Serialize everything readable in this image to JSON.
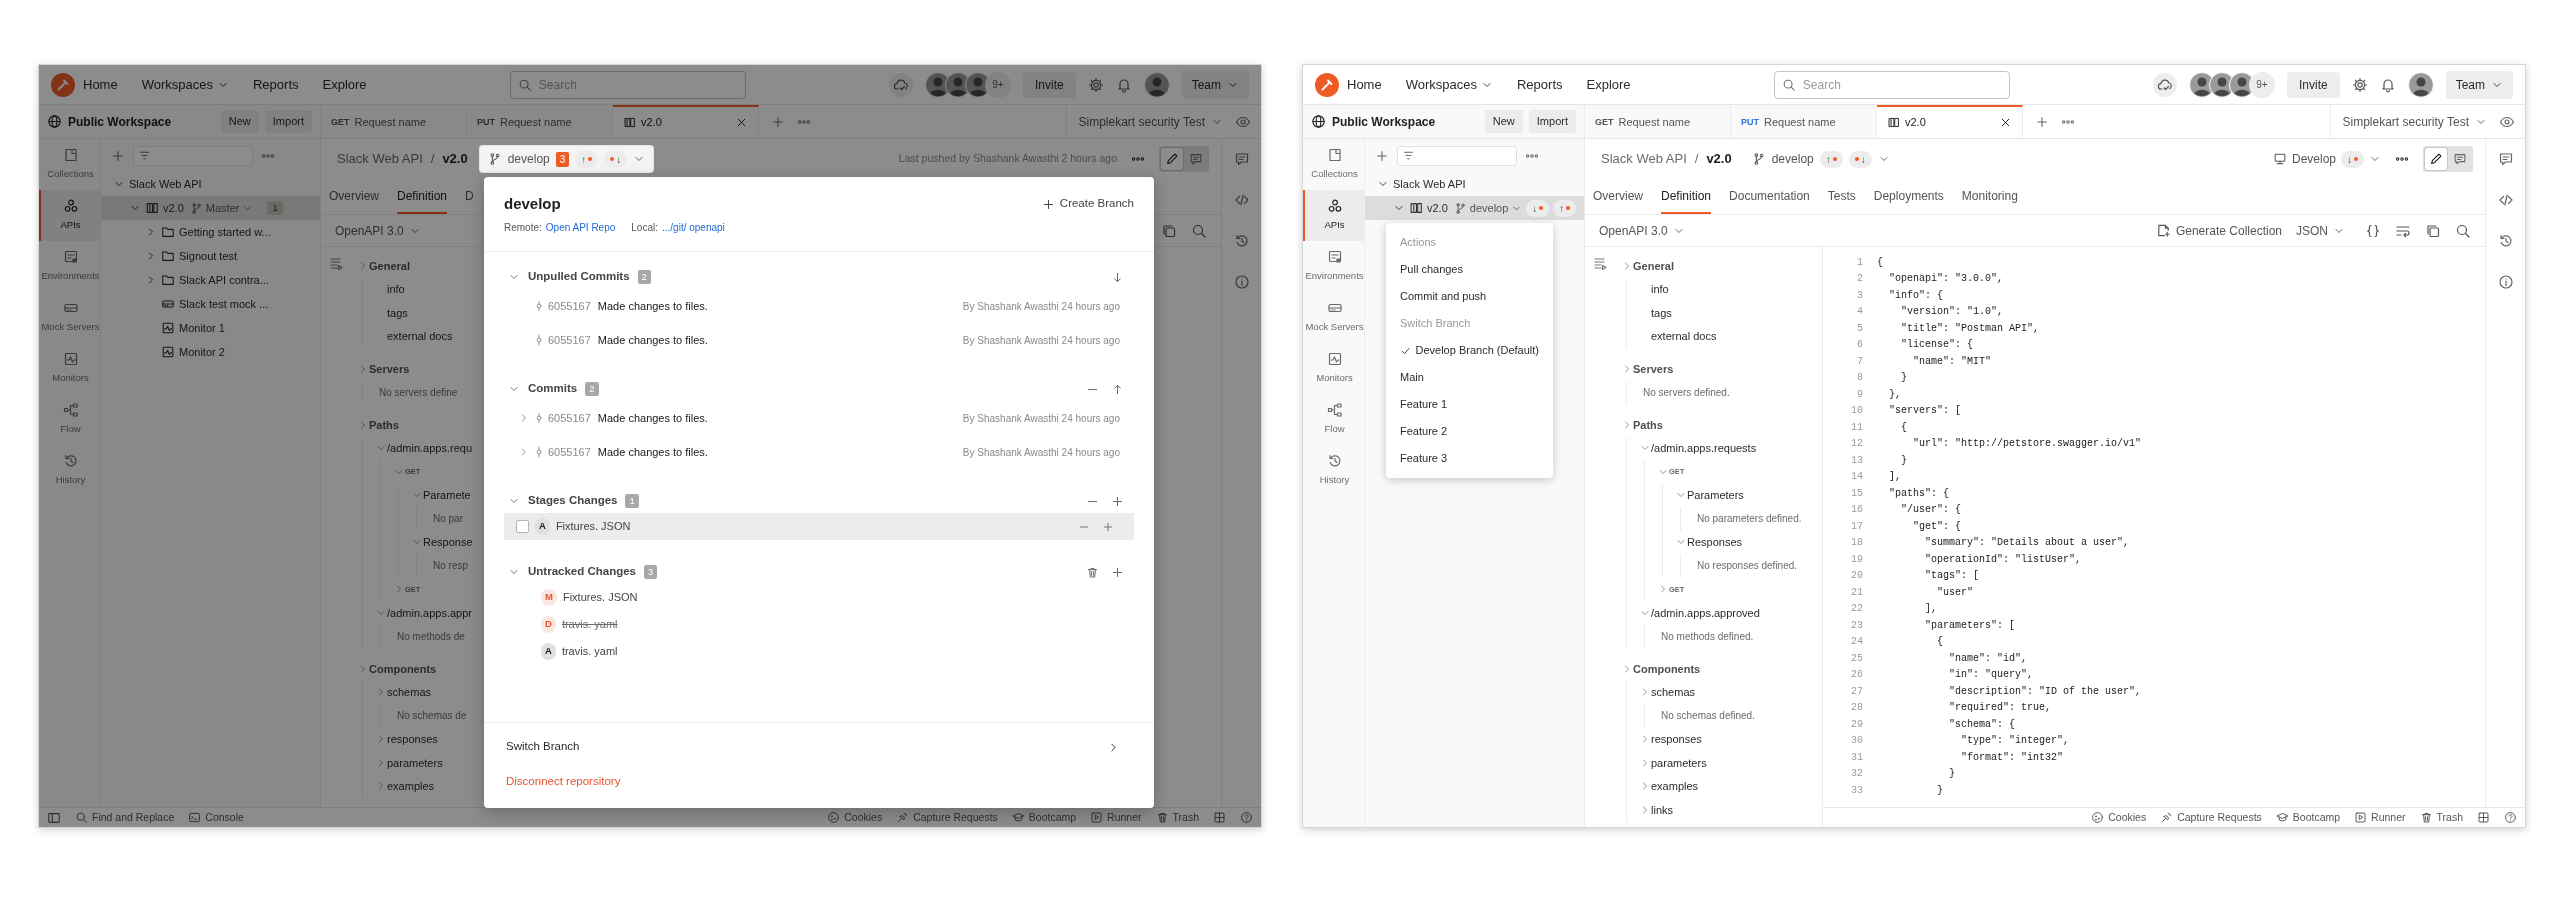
{
  "windows": [
    {
      "dimmed": true,
      "nav": {
        "home": "Home",
        "links": [
          {
            "label": "Workspaces",
            "dropdown": true
          },
          {
            "label": "Reports",
            "dropdown": false
          },
          {
            "label": "Explore",
            "dropdown": false
          }
        ],
        "search": {
          "placeholder": "Search"
        },
        "collaborator_count": "9+",
        "invite": "Invite",
        "team": "Team"
      },
      "workspace": {
        "name": "Public Workspace",
        "buttons": [
          "New",
          "Import"
        ]
      },
      "tabs": [
        {
          "method": "GET",
          "label": "Request name",
          "selected": false
        },
        {
          "method": "PUT",
          "label": "Request name",
          "selected": false
        },
        {
          "label": "v2.0",
          "selected": true
        }
      ],
      "environment": "Simplekart security Test",
      "rail": [
        {
          "label": "Collections",
          "selected": false
        },
        {
          "label": "APIs",
          "selected": true
        },
        {
          "label": "Environments",
          "selected": false
        },
        {
          "label": "Mock Servers",
          "selected": false
        },
        {
          "label": "Monitors",
          "selected": false
        },
        {
          "label": "Flow",
          "selected": false
        },
        {
          "label": "History",
          "selected": false
        }
      ],
      "sidebar": [
        {
          "label": "Slack Web API",
          "expanded": true,
          "selected": false,
          "children": [
            {
              "label": "v2.0",
              "kind": "api",
              "expanded": true,
              "selected": true,
              "branch": "Master",
              "badge": "1",
              "children": [
                {
                  "label": "Getting started w...",
                  "kind": "folder",
                  "expanded": false,
                  "selected": false
                },
                {
                  "label": "Signout test",
                  "kind": "folder",
                  "expanded": false,
                  "selected": false
                },
                {
                  "label": "Slack API contra...",
                  "kind": "folder",
                  "expanded": false,
                  "selected": false
                },
                {
                  "label": "Slack test mock ...",
                  "kind": "mock",
                  "selected": false
                },
                {
                  "label": "Monitor 1",
                  "kind": "monitor",
                  "selected": false
                },
                {
                  "label": "Monitor 2",
                  "kind": "monitor",
                  "selected": false
                }
              ]
            }
          ]
        }
      ],
      "header": {
        "parent": "Slack Web API",
        "separator": "/",
        "current": "v2.0",
        "branch": {
          "name": "develop",
          "open": true,
          "count": "3",
          "sync": [
            {
              "arrow": "↑",
              "kind": "dot-after"
            },
            {
              "arrow": "↓",
              "kind": "dot-before"
            }
          ]
        },
        "last_pushed": "Last pushed by Shashank Awasthi 2 hours ago"
      },
      "view_toggle": [
        {
          "selected": true
        },
        {
          "selected": false
        }
      ],
      "main_tabs": [
        {
          "label": "Overview",
          "selected": false
        },
        {
          "label": "Definition",
          "selected": true
        },
        {
          "label": "D",
          "selected": false
        }
      ],
      "format": "OpenAPI 3.0",
      "toolbar": {
        "tools": [
          {
            "kind": "copy"
          },
          {
            "kind": "search"
          }
        ]
      },
      "definition": [
        {
          "label": "General",
          "kind": "section",
          "expanded": false,
          "children": [
            {
              "label": "info",
              "kind": "item"
            },
            {
              "label": "tags",
              "kind": "item"
            },
            {
              "label": "external docs",
              "kind": "item"
            }
          ]
        },
        {
          "label": "Servers",
          "kind": "section",
          "expanded": false,
          "children": [
            {
              "label": "No servers define",
              "kind": "note"
            }
          ]
        },
        {
          "label": "Paths",
          "kind": "section",
          "expanded": false,
          "children": [
            {
              "label": "/admin.apps.requ",
              "kind": "item",
              "expanded": true,
              "children": [
                {
                  "label": "GET",
                  "kind": "method",
                  "expanded": true,
                  "children": [
                    {
                      "label": "Paramete",
                      "kind": "item",
                      "expanded": true,
                      "children": [
                        {
                          "label": "No par",
                          "kind": "note"
                        }
                      ]
                    },
                    {
                      "label": "Response",
                      "kind": "item",
                      "expanded": true,
                      "children": [
                        {
                          "label": "No resp",
                          "kind": "note"
                        }
                      ]
                    }
                  ]
                },
                {
                  "label": "GET",
                  "kind": "method",
                  "expanded": false
                }
              ]
            },
            {
              "label": "/admin.apps.appr",
              "kind": "item",
              "expanded": true,
              "children": [
                {
                  "label": "No methods de",
                  "kind": "note"
                }
              ]
            }
          ]
        },
        {
          "label": "Components",
          "kind": "section",
          "expanded": false,
          "children": [
            {
              "label": "schemas",
              "kind": "item",
              "expanded": false,
              "children": [
                {
                  "label": "No schemas de",
                  "kind": "note"
                }
              ]
            },
            {
              "label": "responses",
              "kind": "item",
              "expanded": false
            },
            {
              "label": "parameters",
              "kind": "item",
              "expanded": false
            },
            {
              "label": "examples",
              "kind": "item",
              "expanded": false
            }
          ]
        }
      ],
      "status_bar": {
        "kind": "window",
        "left": [
          {
            "kind": "find",
            "label": "Find and Replace"
          },
          {
            "kind": "console",
            "label": "Console"
          }
        ],
        "right": [
          {
            "kind": "cookies",
            "label": "Cookies"
          },
          {
            "kind": "capture",
            "label": "Capture Requests"
          },
          {
            "kind": "bootcamp",
            "label": "Bootcamp"
          },
          {
            "kind": "runner",
            "label": "Runner"
          },
          {
            "kind": "trash",
            "label": "Trash"
          }
        ]
      },
      "modal": {
        "title": "develop",
        "create": "Create Branch",
        "remote_label": "Remote:",
        "remote": "Open API Repo",
        "local_label": "Local:",
        "local": ".../git/ openapi",
        "sections": [
          {
            "title": "Unpulled Commits",
            "count": "2",
            "expanded": true,
            "actions": [
              {
                "kind": "pull"
              }
            ],
            "items": [
              {
                "kind": "commit",
                "hash": "6055167",
                "message": "Made changes to files.",
                "author": "By Shashank Awasthi 24 hours ago"
              },
              {
                "kind": "commit",
                "hash": "6055167",
                "message": "Made changes to files.",
                "author": "By Shashank Awasthi 24 hours ago"
              }
            ]
          },
          {
            "title": "Commits",
            "count": "2",
            "expanded": true,
            "actions": [
              {
                "kind": "collapse"
              },
              {
                "kind": "push"
              }
            ],
            "items": [
              {
                "kind": "commit",
                "expanded": false,
                "hash": "6055167",
                "message": "Made changes to files.",
                "author": "By Shashank Awasthi 24 hours ago"
              },
              {
                "kind": "commit",
                "expanded": false,
                "hash": "6055167",
                "message": "Made changes to files.",
                "author": "By Shashank Awasthi 24 hours ago"
              }
            ]
          },
          {
            "title": "Stages Changes",
            "count": "1",
            "expanded": true,
            "actions": [
              {
                "kind": "collapse"
              },
              {
                "kind": "stage"
              }
            ],
            "items": [
              {
                "kind": "file",
                "letter": "A",
                "color": "#212121",
                "deleted": false,
                "name": "Fixtures. JSON",
                "checked": false,
                "highlighted": true,
                "actions": [
                  {
                    "kind": "unstage"
                  },
                  {
                    "kind": "stage"
                  }
                ]
              }
            ]
          },
          {
            "title": "Untracked Changes",
            "count": "3",
            "expanded": true,
            "actions": [
              {
                "kind": "discard"
              },
              {
                "kind": "stage"
              }
            ],
            "items": [
              {
                "kind": "file",
                "letter": "M",
                "color": "#e5532e",
                "deleted": false,
                "name": "Fixtures. JSON",
                "highlighted": false
              },
              {
                "kind": "file",
                "letter": "D",
                "color": "#e5532e",
                "deleted": true,
                "name": "travis. yaml",
                "highlighted": false
              },
              {
                "kind": "file",
                "letter": "A",
                "color": "#212121",
                "deleted": false,
                "name": "travis. yaml",
                "highlighted": false
              }
            ]
          }
        ],
        "switch": "Switch Branch",
        "disconnect": "Disconnect reporsitory"
      }
    },
    {
      "dimmed": false,
      "nav": {
        "home": "Home",
        "links": [
          {
            "label": "Workspaces",
            "dropdown": true
          },
          {
            "label": "Reports",
            "dropdown": false
          },
          {
            "label": "Explore",
            "dropdown": false
          }
        ],
        "search": {
          "placeholder": "Search"
        },
        "collaborator_count": "9+",
        "invite": "Invite",
        "team": "Team"
      },
      "workspace": {
        "name": "Public Workspace",
        "buttons": [
          "New",
          "Import"
        ]
      },
      "tabs": [
        {
          "method": "GET",
          "color": "#555555",
          "label": "Request name",
          "selected": false
        },
        {
          "method": "PUT",
          "color": "#2f72d8",
          "label": "Request name",
          "selected": false
        },
        {
          "label": "v2.0",
          "selected": true
        }
      ],
      "environment": "Simplekart security Test",
      "rail": [
        {
          "label": "Collections",
          "selected": false
        },
        {
          "label": "APIs",
          "selected": true
        },
        {
          "label": "Environments",
          "selected": false
        },
        {
          "label": "Mock Servers",
          "selected": false
        },
        {
          "label": "Monitors",
          "selected": false
        },
        {
          "label": "Flow",
          "selected": false
        },
        {
          "label": "History",
          "selected": false
        }
      ],
      "sidebar": [
        {
          "label": "Slack Web API",
          "expanded": true,
          "selected": false,
          "children": [
            {
              "label": "v2.0",
              "kind": "api",
              "expanded": true,
              "selected": true,
              "branch": "develop",
              "sync": [
                {
                  "arrow": "↓",
                  "kind": "dot-after"
                },
                {
                  "arrow": "↑",
                  "kind": "dot-after"
                }
              ]
            }
          ]
        }
      ],
      "menu": [
        {
          "kind": "header",
          "label": "Actions"
        },
        {
          "kind": "item",
          "label": "Pull changes",
          "checked": false
        },
        {
          "kind": "item",
          "label": "Commit and push",
          "checked": false
        },
        {
          "kind": "header",
          "label": "Switch Branch"
        },
        {
          "kind": "item",
          "label": "Develop Branch (Default)",
          "checked": true
        },
        {
          "kind": "item",
          "label": "Main",
          "checked": false
        },
        {
          "kind": "item",
          "label": "Feature 1",
          "checked": false
        },
        {
          "kind": "item",
          "label": "Feature 2",
          "checked": false
        },
        {
          "kind": "item",
          "label": "Feature 3",
          "checked": false
        }
      ],
      "header": {
        "parent": "Slack Web API",
        "separator": "/",
        "current": "v2.0",
        "branch": {
          "name": "develop",
          "open": false,
          "sync": [
            {
              "arrow": "↑",
              "kind": "dot-after"
            },
            {
              "arrow": "↓",
              "kind": "dot-before"
            }
          ]
        },
        "environment": {
          "label": "Develop",
          "sync": {
            "arrow": "↓",
            "kind": "dot-after"
          }
        }
      },
      "view_toggle": [
        {
          "selected": true
        },
        {
          "selected": false
        }
      ],
      "main_tabs": [
        {
          "label": "Overview",
          "selected": false
        },
        {
          "label": "Definition",
          "selected": true
        },
        {
          "label": "Documentation",
          "selected": false
        },
        {
          "label": "Tests",
          "selected": false
        },
        {
          "label": "Deployments",
          "selected": false
        },
        {
          "label": "Monitoring",
          "selected": false
        }
      ],
      "format": "OpenAPI 3.0",
      "toolbar": {
        "generate": "Generate Collection",
        "format": "JSON",
        "tools": [
          {
            "kind": "beautify"
          },
          {
            "kind": "wrap"
          },
          {
            "kind": "copy"
          },
          {
            "kind": "search"
          }
        ]
      },
      "definition": [
        {
          "label": "General",
          "kind": "section",
          "expanded": false,
          "children": [
            {
              "label": "info",
              "kind": "item"
            },
            {
              "label": "tags",
              "kind": "item"
            },
            {
              "label": "external docs",
              "kind": "item"
            }
          ]
        },
        {
          "label": "Servers",
          "kind": "section",
          "expanded": false,
          "children": [
            {
              "label": "No servers defined.",
              "kind": "note"
            }
          ]
        },
        {
          "label": "Paths",
          "kind": "section",
          "expanded": false,
          "children": [
            {
              "label": "/admin.apps.requests",
              "kind": "item",
              "expanded": true,
              "children": [
                {
                  "label": "GET",
                  "kind": "method",
                  "expanded": true,
                  "children": [
                    {
                      "label": "Parameters",
                      "kind": "item",
                      "expanded": true,
                      "children": [
                        {
                          "label": "No parameters defined.",
                          "kind": "note"
                        }
                      ]
                    },
                    {
                      "label": "Responses",
                      "kind": "item",
                      "expanded": true,
                      "children": [
                        {
                          "label": "No responses defined.",
                          "kind": "note"
                        }
                      ]
                    }
                  ]
                },
                {
                  "label": "GET",
                  "kind": "method",
                  "expanded": false
                }
              ]
            },
            {
              "label": "/admin.apps.approved",
              "kind": "item",
              "expanded": true,
              "children": [
                {
                  "label": "No methods defined.",
                  "kind": "note"
                }
              ]
            }
          ]
        },
        {
          "label": "Components",
          "kind": "section",
          "expanded": false,
          "children": [
            {
              "label": "schemas",
              "kind": "item",
              "expanded": false,
              "children": [
                {
                  "label": "No schemas defined.",
                  "kind": "note"
                }
              ]
            },
            {
              "label": "responses",
              "kind": "item",
              "expanded": false
            },
            {
              "label": "parameters",
              "kind": "item",
              "expanded": false
            },
            {
              "label": "examples",
              "kind": "item",
              "expanded": false
            },
            {
              "label": "links",
              "kind": "item",
              "expanded": false
            }
          ]
        }
      ],
      "code": [
        {
          "n": "1",
          "text": "{"
        },
        {
          "n": "2",
          "text": "  \"openapi\": \"3.0.0\","
        },
        {
          "n": "3",
          "text": "  \"info\": {"
        },
        {
          "n": "4",
          "text": "    \"version\": \"1.0\","
        },
        {
          "n": "5",
          "text": "    \"title\": \"Postman API\","
        },
        {
          "n": "6",
          "text": "    \"license\": {"
        },
        {
          "n": "7",
          "text": "      \"name\": \"MIT\""
        },
        {
          "n": "8",
          "text": "    }"
        },
        {
          "n": "9",
          "text": "  },"
        },
        {
          "n": "10",
          "text": "  \"servers\": ["
        },
        {
          "n": "11",
          "text": "    {"
        },
        {
          "n": "12",
          "text": "      \"url\": \"http://petstore.swagger.io/v1\""
        },
        {
          "n": "13",
          "text": "    }"
        },
        {
          "n": "14",
          "text": "  ],"
        },
        {
          "n": "15",
          "text": "  \"paths\": {"
        },
        {
          "n": "16",
          "text": "    \"/user\": {"
        },
        {
          "n": "17",
          "text": "      \"get\": {"
        },
        {
          "n": "18",
          "text": "        \"summary\": \"Details about a user\","
        },
        {
          "n": "19",
          "text": "        \"operationId\": \"listUser\","
        },
        {
          "n": "20",
          "text": "        \"tags\": ["
        },
        {
          "n": "21",
          "text": "          \"user\""
        },
        {
          "n": "22",
          "text": "        ],"
        },
        {
          "n": "23",
          "text": "        \"parameters\": ["
        },
        {
          "n": "24",
          "text": "          {"
        },
        {
          "n": "25",
          "text": "            \"name\": \"id\","
        },
        {
          "n": "26",
          "text": "            \"in\": \"query\","
        },
        {
          "n": "27",
          "text": "            \"description\": \"ID of the user\","
        },
        {
          "n": "28",
          "text": "            \"required\": true,"
        },
        {
          "n": "29",
          "text": "            \"schema\": {"
        },
        {
          "n": "30",
          "text": "              \"type\": \"integer\","
        },
        {
          "n": "31",
          "text": "              \"format\": \"int32\""
        },
        {
          "n": "32",
          "text": "            }"
        },
        {
          "n": "33",
          "text": "          }"
        }
      ],
      "status_bar": {
        "kind": "editor",
        "right": [
          {
            "kind": "cookies",
            "label": "Cookies"
          },
          {
            "kind": "capture",
            "label": "Capture Requests"
          },
          {
            "kind": "bootcamp",
            "label": "Bootcamp"
          },
          {
            "kind": "runner",
            "label": "Runner"
          },
          {
            "kind": "trash",
            "label": "Trash"
          }
        ]
      }
    }
  ]
}
